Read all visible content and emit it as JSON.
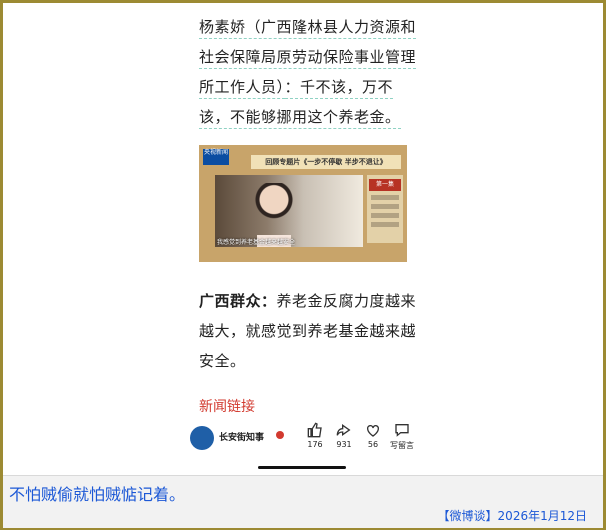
{
  "article": {
    "p1_name": "杨素娇（广西隆林县人力资源和社会保障局原劳动保险事业管理所工作人员）",
    "p1_text": "：千不该，万不该，不能够挪用这个养老金。",
    "video": {
      "tag": "央视新闻",
      "banner": "回顾专题片《一步不停歇 半步不退让》",
      "caption": "我感觉到养老基金越来越安全",
      "side_label": "第一集"
    },
    "p2_name": "广西群众：",
    "p2_text": "养老金反腐力度越来越大，就感觉到养老基金越来越安全。",
    "link": "新闻链接"
  },
  "footer": {
    "account": "长安街知事",
    "metrics": [
      {
        "icon": "thumb-up-icon",
        "count": "176"
      },
      {
        "icon": "share-icon",
        "count": "931"
      },
      {
        "icon": "heart-icon",
        "count": "56"
      },
      {
        "icon": "comment-icon",
        "count": "写留言"
      }
    ]
  },
  "overlay": {
    "message": "不怕贼偷就怕贼惦记着。",
    "stamp": "【微博谈】2026年1月12日"
  },
  "colors": {
    "link": "#d23a2f",
    "overlay_text": "#1c58d6",
    "frame": "#9c8a33"
  }
}
